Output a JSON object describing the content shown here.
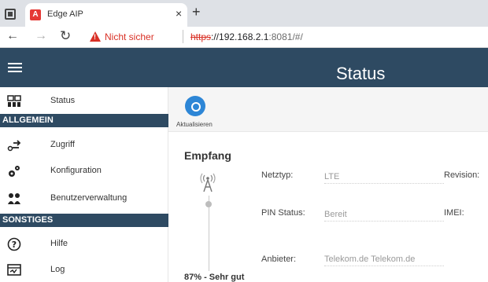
{
  "browser": {
    "tab_title": "Edge AIP",
    "tab_close": "×",
    "new_tab": "+",
    "security_text": "Nicht sicher",
    "url_scheme": "https",
    "url_host": "://192.168.2.1",
    "url_rest": ":8081/#/"
  },
  "header": {
    "title": "Status"
  },
  "sidebar": {
    "status": "Status",
    "section_allgemein": "ALLGEMEIN",
    "zugriff": "Zugriff",
    "konfiguration": "Konfiguration",
    "benutzerverwaltung": "Benutzerverwaltung",
    "section_sonstiges": "SONSTIGES",
    "hilfe": "Hilfe",
    "log": "Log"
  },
  "toolbar": {
    "refresh_label": "Aktualisieren"
  },
  "empfang": {
    "title": "Empfang",
    "signal_text": "87% - Sehr gut"
  },
  "fields": {
    "netztyp_label": "Netztyp:",
    "netztyp_value": "LTE",
    "pin_label": "PIN Status:",
    "pin_value": "Bereit",
    "anbieter_label": "Anbieter:",
    "anbieter_value": "Telekom.de Telekom.de",
    "revision_label": "Revision:",
    "imei_label": "IMEI:"
  },
  "colors": {
    "header": "#2e4a62",
    "accent": "#2d86d6",
    "warning": "#d93025"
  }
}
